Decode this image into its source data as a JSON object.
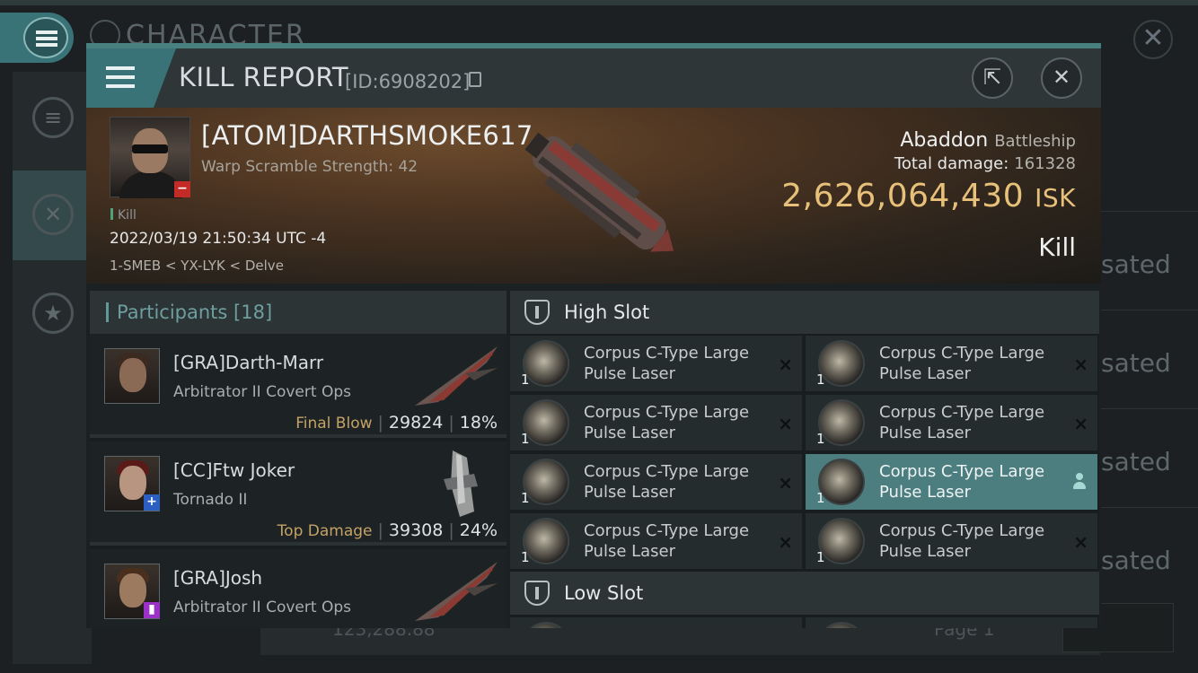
{
  "background": {
    "header": "CHARACTER",
    "list_rows": [
      "sated",
      "sated",
      "sated",
      "sated"
    ],
    "footer_value": "123,288.88",
    "footer_page": "Page 1"
  },
  "modal": {
    "title": "KILL REPORT",
    "id": "[ID:6908202]",
    "copy_icon": "copy-icon",
    "share_icon": "external-link-icon",
    "close_icon": "close-icon"
  },
  "victim": {
    "name": "[ATOM]DARTHSMOKE617",
    "warp_scramble": "Warp Scramble Strength: 42",
    "tag": "Kill",
    "datetime": "2022/03/19 21:50:34 UTC -4",
    "location": "1-SMEB < YX-LYK < Delve",
    "ship": "Abaddon",
    "ship_class": "Battleship",
    "total_damage_label": "Total damage:",
    "total_damage": "161328",
    "isk_value": "2,626,064,430",
    "isk_unit": "ISK",
    "result": "Kill"
  },
  "participants": {
    "label": "Participants",
    "count": "[18]",
    "rows": [
      {
        "name": "[GRA]Darth-Marr",
        "ship": "Arbitrator II Covert Ops",
        "role": "Final Blow",
        "damage": "29824",
        "percent": "18%"
      },
      {
        "name": "[CC]Ftw Joker",
        "ship": "Tornado II",
        "role": "Top Damage",
        "damage": "39308",
        "percent": "24%"
      },
      {
        "name": "[GRA]Josh",
        "ship": "Arbitrator II Covert Ops",
        "role": "",
        "damage": "",
        "percent": ""
      }
    ]
  },
  "slots": {
    "high_label": "High Slot",
    "low_label": "Low Slot",
    "high_items": [
      {
        "qty": "1",
        "name": "Corpus C-Type Large Pulse Laser"
      },
      {
        "qty": "1",
        "name": "Corpus C-Type Large Pulse Laser"
      },
      {
        "qty": "1",
        "name": "Corpus C-Type Large Pulse Laser"
      },
      {
        "qty": "1",
        "name": "Corpus C-Type Large Pulse Laser"
      },
      {
        "qty": "1",
        "name": "Corpus C-Type Large Pulse Laser"
      },
      {
        "qty": "1",
        "name": "Corpus C-Type Large Pulse Laser"
      },
      {
        "qty": "1",
        "name": "Corpus C-Type Large Pulse Laser"
      },
      {
        "qty": "1",
        "name": "Corpus C-Type Large Pulse Laser"
      }
    ],
    "destroyed_mark": "×"
  },
  "colors": {
    "accent": "#3a7377",
    "isk_gold": "#e7c07a",
    "selected_item": "#4c7d7f",
    "final_blow": "#c5a265"
  }
}
